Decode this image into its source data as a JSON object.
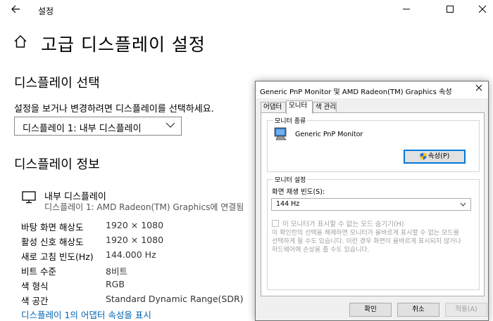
{
  "window": {
    "back_icon": "arrow-left-icon",
    "title": "설정",
    "minimize": "—",
    "maximize": "☐",
    "close": "✕"
  },
  "page": {
    "home_icon": "home-icon",
    "title": "고급 디스플레이 설정"
  },
  "select_display": {
    "heading": "디스플레이 선택",
    "description": "설정을 보거나 변경하려면 디스플레이를 선택하세요.",
    "selected": "디스플레이 1: 내부 디스플레이"
  },
  "display_info": {
    "heading": "디스플레이 정보",
    "monitor_icon": "monitor-icon",
    "name": "내부 디스플레이",
    "connection": "디스플레이 1: AMD Radeon(TM) Graphics에 연결됨",
    "rows": [
      {
        "label": "바탕 화면 해상도",
        "value": "1920 × 1080"
      },
      {
        "label": "활성 신호 해상도",
        "value": "1920 × 1080"
      },
      {
        "label": "새로 고침 빈도(Hz)",
        "value": "144.000 Hz"
      },
      {
        "label": "비트 수준",
        "value": "8비트"
      },
      {
        "label": "색 형식",
        "value": "RGB"
      },
      {
        "label": "색 공간",
        "value": "Standard Dynamic Range(SDR)"
      }
    ],
    "adapter_link": "디스플레이 1의 어댑터 속성을 표시"
  },
  "dialog": {
    "title": "Generic PnP Monitor 및 AMD Radeon(TM) Graphics 속성",
    "close": "✕",
    "tabs": [
      {
        "label": "어댑터"
      },
      {
        "label": "모니터"
      },
      {
        "label": "색 관리"
      }
    ],
    "monitor_type": {
      "legend": "모니터 종류",
      "model": "Generic PnP Monitor",
      "properties_button": "속성(P)"
    },
    "monitor_settings": {
      "legend": "모니터 설정",
      "refresh_label": "화면 재생 빈도(S):",
      "refresh_value": "144 Hz",
      "hide_modes_label": "이 모니터가 표시할 수 없는 모드 숨기기(H)",
      "hide_modes_checked": false,
      "description_lines": [
        "이 확인란의 선택을 해제하면 모니터가 올바르게 표시할 수 없는 모드를",
        "선택하게 될 수도 있습니다. 이런 경우 화면이 올바르게 표시되지 않거나",
        "하드웨어에 손상을 줄 수도 있습니다."
      ]
    },
    "buttons": {
      "ok": "확인",
      "cancel": "취소",
      "apply": "적용(A)"
    }
  }
}
